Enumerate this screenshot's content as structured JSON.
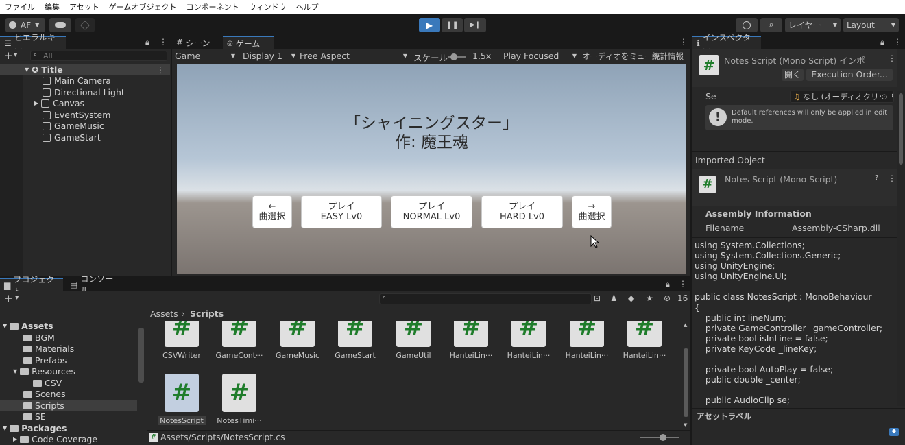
{
  "menubar": [
    "ファイル",
    "編集",
    "アセット",
    "ゲームオブジェクト",
    "コンポーネント",
    "ウィンドウ",
    "ヘルプ"
  ],
  "toolbar": {
    "account": "AF",
    "layers": "レイヤー",
    "layout": "Layout"
  },
  "hierarchy": {
    "tab": "ヒエラルキー",
    "search_placeholder": "All",
    "scene": "Title",
    "items": [
      "Main Camera",
      "Directional Light",
      "Canvas",
      "EventSystem",
      "GameMusic",
      "GameStart"
    ]
  },
  "scene_view": {
    "tabs": [
      "シーン",
      "ゲーム"
    ],
    "game_dropdown": "Game",
    "display": "Display 1",
    "aspect": "Free Aspect",
    "scale_label": "スケール",
    "scale_value": "1.5x",
    "play_focused": "Play Focused",
    "mute": "オーディオをミュート",
    "stats": "統計情報",
    "song_title": "「シャイニングスター」",
    "author": "作: 魔王魂",
    "buttons": [
      {
        "line1": "←",
        "line2": "曲選択"
      },
      {
        "line1": "プレイ",
        "line2": "EASY Lv0"
      },
      {
        "line1": "プレイ",
        "line2": "NORMAL Lv0"
      },
      {
        "line1": "プレイ",
        "line2": "HARD Lv0"
      },
      {
        "line1": "→",
        "line2": "曲選択"
      }
    ]
  },
  "inspector": {
    "tab": "インスペクター",
    "script_title": "Notes Script (Mono Script) インポ",
    "open_btn": "開く",
    "exec_order_btn": "Execution Order...",
    "se_label": "Se",
    "se_value": "なし (オーディオクリップ)",
    "info": "Default references will only be applied in edit mode.",
    "imported_object": "Imported Object",
    "mono_title": "Notes Script (Mono Script)",
    "assembly_header": "Assembly Information",
    "filename_label": "Filename",
    "filename_value": "Assembly-CSharp.dll",
    "code": "using System.Collections;\nusing System.Collections.Generic;\nusing UnityEngine;\nusing UnityEngine.UI;\n\npublic class NotesScript : MonoBehaviour\n{\n    public int lineNum;\n    private GameController _gameController;\n    private bool isInLine = false;\n    private KeyCode _lineKey;\n\n    private bool AutoPlay = false;\n    public double _center;\n\n    public AudioClip se;",
    "asset_labels": "アセットラベル"
  },
  "project": {
    "tabs": [
      "プロジェクト",
      "コンソール"
    ],
    "hidden_count": "16",
    "tree": [
      {
        "label": "Assets",
        "depth": 0,
        "bold": true
      },
      {
        "label": "BGM",
        "depth": 1
      },
      {
        "label": "Materials",
        "depth": 1
      },
      {
        "label": "Prefabs",
        "depth": 1
      },
      {
        "label": "Resources",
        "depth": 1
      },
      {
        "label": "CSV",
        "depth": 2
      },
      {
        "label": "Scenes",
        "depth": 1
      },
      {
        "label": "Scripts",
        "depth": 1
      },
      {
        "label": "SE",
        "depth": 1
      },
      {
        "label": "Packages",
        "depth": 0,
        "bold": true
      },
      {
        "label": "Code Coverage",
        "depth": 1
      }
    ],
    "breadcrumb_root": "Assets",
    "breadcrumb_current": "Scripts",
    "assets_row1": [
      "CSVWriter",
      "GameCont···",
      "GameMusic",
      "GameStart",
      "GameUtil",
      "HanteiLin···",
      "HanteiLin···",
      "HanteiLin···",
      "HanteiLin···"
    ],
    "assets_row2": [
      "NotesScript",
      "NotesTimi···"
    ],
    "status_path": "Assets/Scripts/NotesScript.cs"
  }
}
